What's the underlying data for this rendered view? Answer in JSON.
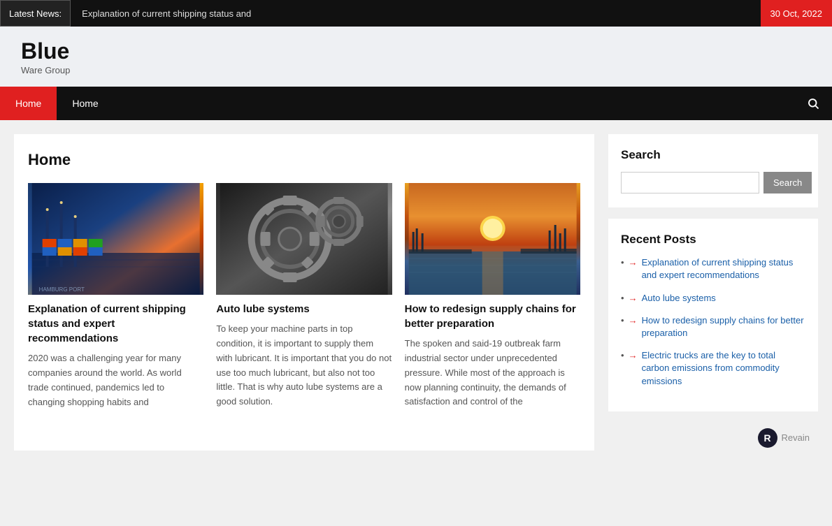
{
  "topbar": {
    "badge": "Latest News:",
    "ticker": "Explanation of current shipping status and",
    "date": "30 Oct, 2022"
  },
  "header": {
    "title": "Blue",
    "subtitle": "Ware Group"
  },
  "nav": {
    "items": [
      {
        "label": "Home",
        "active": true
      },
      {
        "label": "Home",
        "active": false
      }
    ],
    "search_icon": "🔍"
  },
  "content": {
    "title": "Home",
    "articles": [
      {
        "img_type": "shipping",
        "headline": "Explanation of current shipping status and expert recommendations",
        "excerpt": "2020 was a challenging year for many companies around the world. As world trade continued, pandemics led to changing shopping habits and"
      },
      {
        "img_type": "gears",
        "headline": "Auto lube systems",
        "excerpt": "To keep your machine parts in top condition, it is important to supply them with lubricant. It is important that you do not use too much lubricant, but also not too little. That is why auto lube systems are a good solution."
      },
      {
        "img_type": "sunset",
        "headline": "How to redesign supply chains for better preparation",
        "excerpt": "The spoken and said-19 outbreak farm industrial sector under unprecedented pressure. While most of the approach is now planning continuity, the demands of satisfaction and control of the"
      }
    ]
  },
  "sidebar": {
    "search_widget": {
      "title": "Search",
      "input_placeholder": "",
      "button_label": "Search"
    },
    "recent_posts": {
      "title": "Recent Posts",
      "items": [
        "Explanation of current shipping status and expert recommendations",
        "Auto lube systems",
        "How to redesign supply chains for better preparation",
        "Electric trucks are the key to total carbon emissions from commodity emissions"
      ]
    }
  }
}
